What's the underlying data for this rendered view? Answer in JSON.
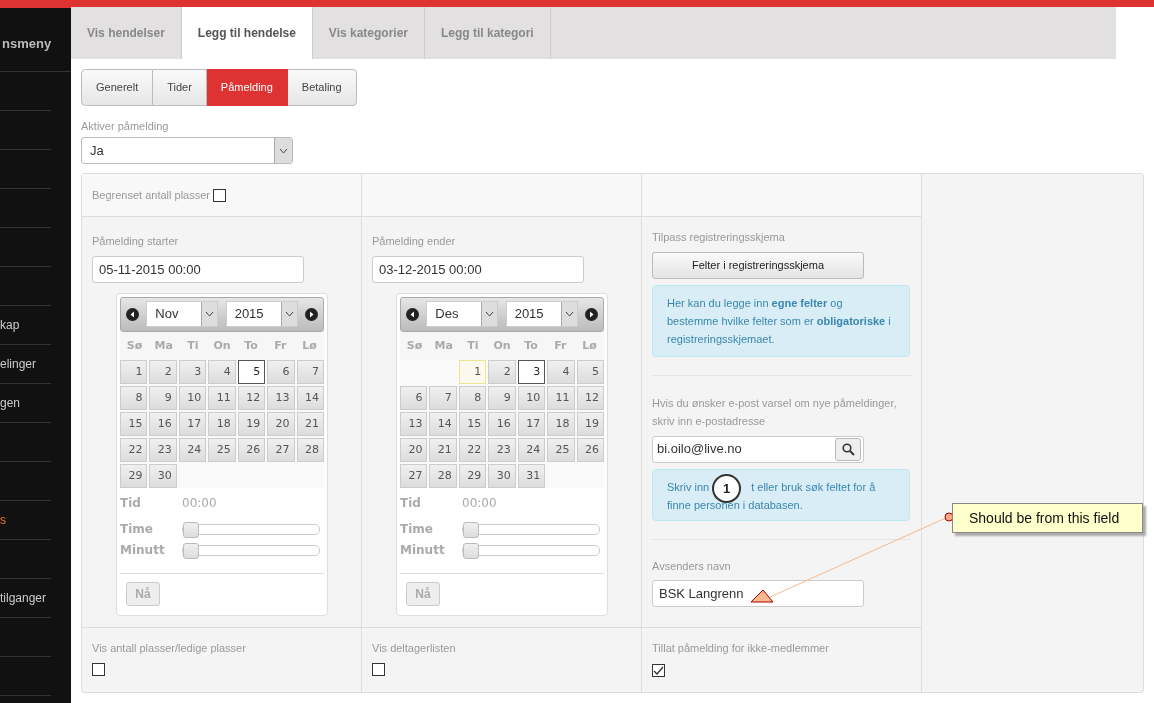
{
  "sidebar": {
    "title": "nsmeny",
    "rows": [
      {
        "kind": "blank"
      },
      {
        "kind": "blank"
      },
      {
        "kind": "blank"
      },
      {
        "kind": "blank"
      },
      {
        "kind": "blank"
      },
      {
        "kind": "blank"
      },
      {
        "kind": "item",
        "label": "kap",
        "selected": false
      },
      {
        "kind": "item",
        "label": "elinger",
        "selected": false
      },
      {
        "kind": "item",
        "label": "gen",
        "selected": false
      },
      {
        "kind": "blank"
      },
      {
        "kind": "blank"
      },
      {
        "kind": "item",
        "label": "s",
        "selected": true
      },
      {
        "kind": "blank"
      },
      {
        "kind": "item",
        "label": "tilganger",
        "selected": false
      },
      {
        "kind": "blank"
      },
      {
        "kind": "blank"
      }
    ]
  },
  "tabs": [
    {
      "label": "Vis hendelser",
      "selected": false
    },
    {
      "label": "Legg til hendelse",
      "selected": true
    },
    {
      "label": "Vis kategorier",
      "selected": false
    },
    {
      "label": "Legg til kategori",
      "selected": false
    }
  ],
  "subtabs": [
    {
      "label": "Generelt",
      "selected": false
    },
    {
      "label": "Tider",
      "selected": false
    },
    {
      "label": "Påmelding",
      "selected": true
    },
    {
      "label": "Betaling",
      "selected": false
    }
  ],
  "activate": {
    "label": "Aktiver påmelding",
    "value": "Ja"
  },
  "limit": {
    "label": "Begrenset antall plasser",
    "checked": false
  },
  "periods": [
    {
      "label": "Påmelding starter",
      "value": "05-11-2015 00:00",
      "calendar": {
        "month": "Nov",
        "year": "2015",
        "weekdays": [
          "Sø",
          "Ma",
          "Ti",
          "On",
          "To",
          "Fr",
          "Lø"
        ],
        "weeks": [
          [
            {
              "day": "1",
              "selected": false,
              "today": false
            },
            {
              "day": "2",
              "selected": false,
              "today": false
            },
            {
              "day": "3",
              "selected": false,
              "today": false
            },
            {
              "day": "4",
              "selected": false,
              "today": false
            },
            {
              "day": "5",
              "selected": true,
              "today": false
            },
            {
              "day": "6",
              "selected": false,
              "today": false
            },
            {
              "day": "7",
              "selected": false,
              "today": false
            }
          ],
          [
            {
              "day": "8",
              "selected": false,
              "today": false
            },
            {
              "day": "9",
              "selected": false,
              "today": false
            },
            {
              "day": "10",
              "selected": false,
              "today": false
            },
            {
              "day": "11",
              "selected": false,
              "today": false
            },
            {
              "day": "12",
              "selected": false,
              "today": false
            },
            {
              "day": "13",
              "selected": false,
              "today": false
            },
            {
              "day": "14",
              "selected": false,
              "today": false
            }
          ],
          [
            {
              "day": "15",
              "selected": false,
              "today": false
            },
            {
              "day": "16",
              "selected": false,
              "today": false
            },
            {
              "day": "17",
              "selected": false,
              "today": false
            },
            {
              "day": "18",
              "selected": false,
              "today": false
            },
            {
              "day": "19",
              "selected": false,
              "today": false
            },
            {
              "day": "20",
              "selected": false,
              "today": false
            },
            {
              "day": "21",
              "selected": false,
              "today": false
            }
          ],
          [
            {
              "day": "22",
              "selected": false,
              "today": false
            },
            {
              "day": "23",
              "selected": false,
              "today": false
            },
            {
              "day": "24",
              "selected": false,
              "today": false
            },
            {
              "day": "25",
              "selected": false,
              "today": false
            },
            {
              "day": "26",
              "selected": false,
              "today": false
            },
            {
              "day": "27",
              "selected": false,
              "today": false
            },
            {
              "day": "28",
              "selected": false,
              "today": false
            }
          ],
          [
            {
              "day": "29",
              "selected": false,
              "today": false
            },
            {
              "day": "30",
              "selected": false,
              "today": false
            }
          ]
        ],
        "time_label": "Tid",
        "time_value": "00:00",
        "sliders": [
          {
            "label": "Time",
            "level": 0
          },
          {
            "label": "Minutt",
            "level": 0
          }
        ],
        "now_button": "Nå"
      }
    },
    {
      "label": "Påmelding ender",
      "value": "03-12-2015 00:00",
      "calendar": {
        "month": "Des",
        "year": "2015",
        "weekdays": [
          "Sø",
          "Ma",
          "Ti",
          "On",
          "To",
          "Fr",
          "Lø"
        ],
        "weeks": [
          [
            {
              "day": "1",
              "selected": false,
              "today": true
            },
            {
              "day": "2",
              "selected": false,
              "today": false
            },
            {
              "day": "3",
              "selected": true,
              "today": false
            },
            {
              "day": "4",
              "selected": false,
              "today": false
            },
            {
              "day": "5",
              "selected": false,
              "today": false
            }
          ],
          [
            {
              "day": "6",
              "selected": false,
              "today": false
            },
            {
              "day": "7",
              "selected": false,
              "today": false
            },
            {
              "day": "8",
              "selected": false,
              "today": false
            },
            {
              "day": "9",
              "selected": false,
              "today": false
            },
            {
              "day": "10",
              "selected": false,
              "today": false
            },
            {
              "day": "11",
              "selected": false,
              "today": false
            },
            {
              "day": "12",
              "selected": false,
              "today": false
            }
          ],
          [
            {
              "day": "13",
              "selected": false,
              "today": false
            },
            {
              "day": "14",
              "selected": false,
              "today": false
            },
            {
              "day": "15",
              "selected": false,
              "today": false
            },
            {
              "day": "16",
              "selected": false,
              "today": false
            },
            {
              "day": "17",
              "selected": false,
              "today": false
            },
            {
              "day": "18",
              "selected": false,
              "today": false
            },
            {
              "day": "19",
              "selected": false,
              "today": false
            }
          ],
          [
            {
              "day": "20",
              "selected": false,
              "today": false
            },
            {
              "day": "21",
              "selected": false,
              "today": false
            },
            {
              "day": "22",
              "selected": false,
              "today": false
            },
            {
              "day": "23",
              "selected": false,
              "today": false
            },
            {
              "day": "24",
              "selected": false,
              "today": false
            },
            {
              "day": "25",
              "selected": false,
              "today": false
            },
            {
              "day": "26",
              "selected": false,
              "today": false
            }
          ],
          [
            {
              "day": "27",
              "selected": false,
              "today": false
            },
            {
              "day": "28",
              "selected": false,
              "today": false
            },
            {
              "day": "29",
              "selected": false,
              "today": false
            },
            {
              "day": "30",
              "selected": false,
              "today": false
            },
            {
              "day": "31",
              "selected": false,
              "today": false
            }
          ]
        ],
        "time_label": "Tid",
        "time_value": "00:00",
        "sliders": [
          {
            "label": "Time",
            "level": 0
          },
          {
            "label": "Minutt",
            "level": 0
          }
        ],
        "now_button": "Nå"
      }
    }
  ],
  "form": {
    "label": "Tilpass registreringsskjema",
    "button": "Felter i registreringsskjema",
    "info": "Her kan du legge inn **egne felter** og bestemme hvilke felter som er **obligatoriske** i registreringsskjemaet."
  },
  "notify": {
    "label": "Hvis du ønsker e-post varsel om nye påmeldinger, skriv inn e-postadresse",
    "value": "bi.oilo@live.no",
    "info_start": "Skriv inn",
    "info_end": "t eller bruk søk feltet for å finne personen i databasen."
  },
  "sender": {
    "label": "Avsenders navn",
    "value": "BSK Langrenn"
  },
  "options": [
    {
      "label": "Vis antall plasser/ledige plasser",
      "checked": false
    },
    {
      "label": "Vis deltagerlisten",
      "checked": false
    },
    {
      "label": "Tillat påmelding for ikke-medlemmer",
      "checked": true
    }
  ],
  "annotation": {
    "marker": "1",
    "callout": "Should be from this field"
  }
}
